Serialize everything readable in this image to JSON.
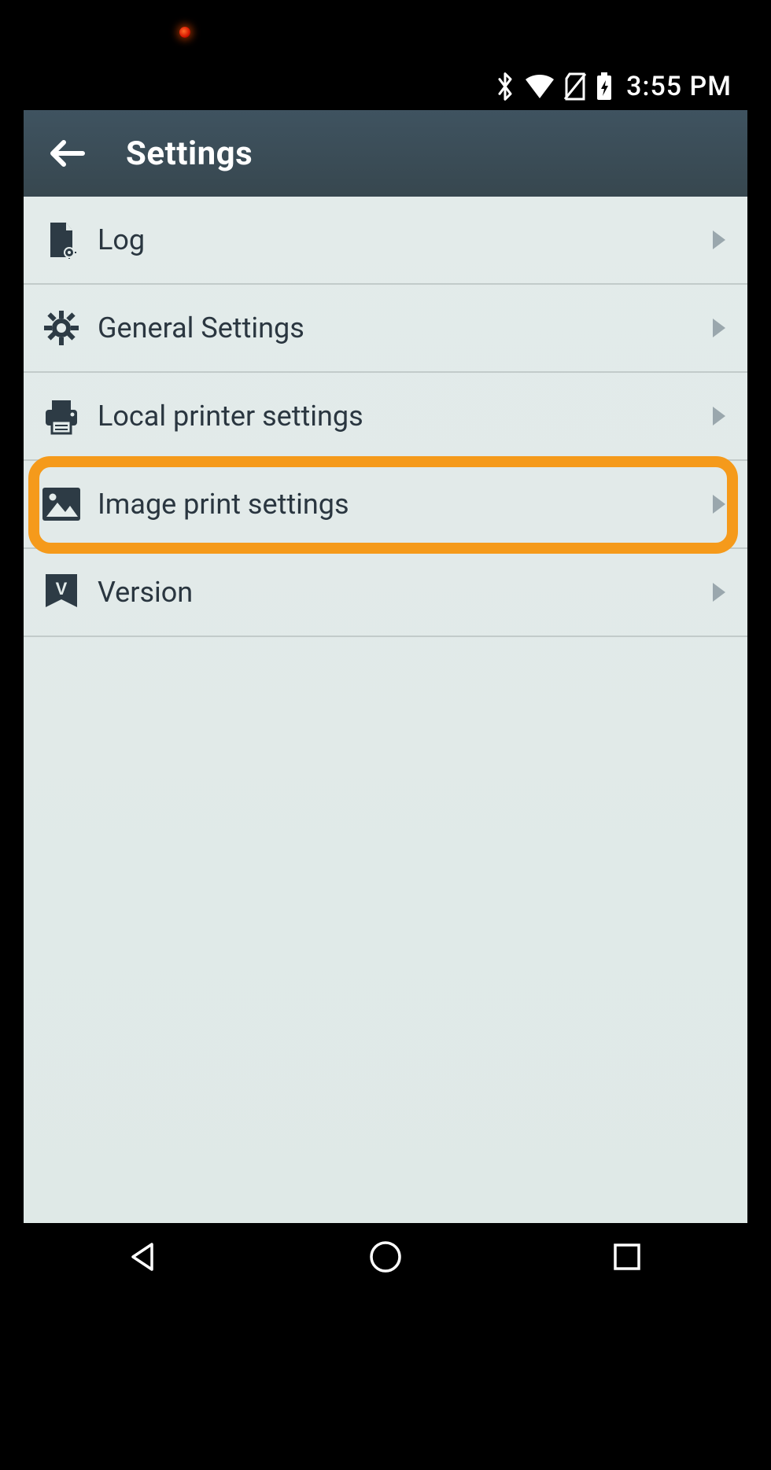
{
  "status_bar": {
    "time": "3:55 PM",
    "icons": [
      "bluetooth",
      "wifi",
      "no-sim",
      "battery-charging"
    ]
  },
  "app_bar": {
    "title": "Settings"
  },
  "menu": {
    "items": [
      {
        "icon": "file-gear-icon",
        "label": "Log"
      },
      {
        "icon": "gear-icon",
        "label": "General Settings"
      },
      {
        "icon": "printer-icon",
        "label": "Local printer settings"
      },
      {
        "icon": "image-icon",
        "label": "Image print settings",
        "highlighted": true
      },
      {
        "icon": "version-badge-icon",
        "label": "Version"
      }
    ]
  },
  "colors": {
    "highlight": "#f59a1b",
    "appbar": "#3b4d5a",
    "row_text": "#2a3640",
    "content_bg": "#e4eceb"
  }
}
